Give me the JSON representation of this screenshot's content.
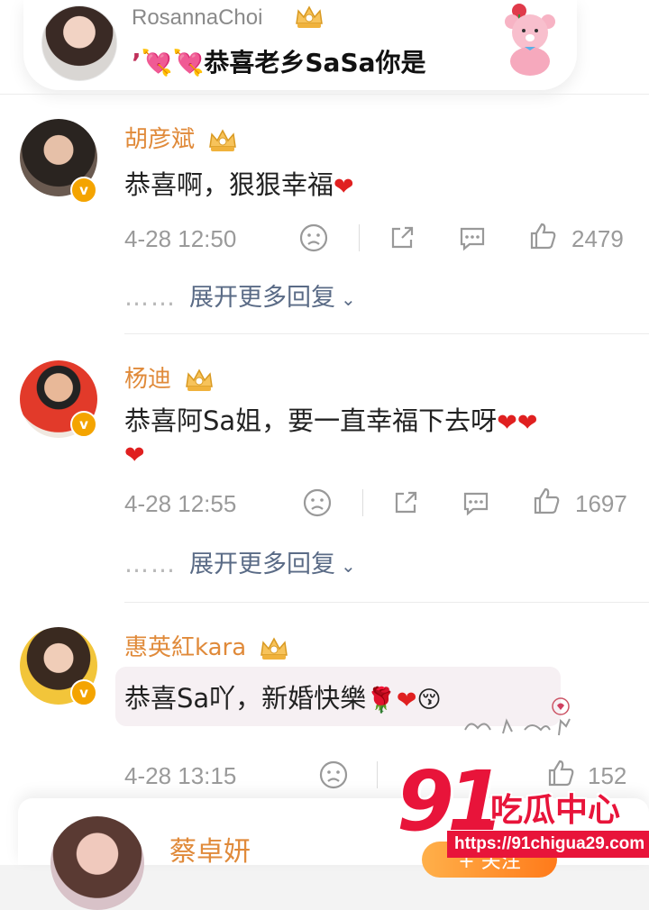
{
  "pinned": {
    "name": "RosannaChoi",
    "text": "恭喜老乡SaSa你是"
  },
  "comments": [
    {
      "name": "胡彦斌",
      "text": "恭喜啊，狠狠幸福",
      "time": "4-28 12:50",
      "likes": "2479",
      "more": "展开更多回复"
    },
    {
      "name": "杨迪",
      "text": "恭喜阿Sa姐，要一直幸福下去呀",
      "time": "4-28 12:55",
      "likes": "1697",
      "more": "展开更多回复"
    },
    {
      "name": "惠英紅kara",
      "text": "恭喜Sa吖，新婚快樂",
      "time": "4-28 13:15",
      "likes": "152"
    }
  ],
  "bottom": {
    "name": "蔡卓妍",
    "follow_label": "+ 关注"
  },
  "watermark": {
    "number": "91",
    "title": "吃瓜中心",
    "url": "https://91chigua29.com"
  },
  "colors": {
    "name_orange": "#e08a3a",
    "link_blue": "#5a6b86",
    "heart_red": "#e02020",
    "watermark_red": "#e8143a",
    "verified_gold": "#f4a400"
  },
  "icons": [
    "crown-icon",
    "dislike-face-icon",
    "share-icon",
    "reply-icon",
    "like-icon",
    "chevron-down-icon",
    "verified-icon",
    "heart-icon",
    "rose-icon"
  ]
}
